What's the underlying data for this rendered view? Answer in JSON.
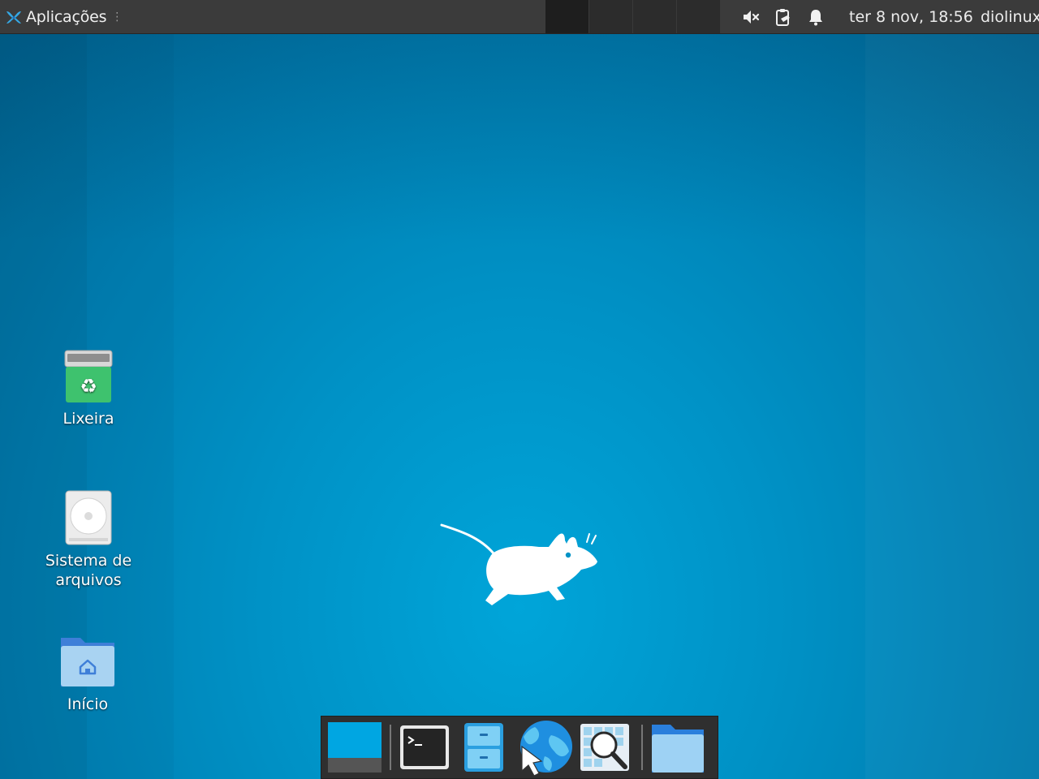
{
  "top_panel": {
    "apps_menu": {
      "label": "Aplicações",
      "icon": "xfce-logo-icon",
      "handle": "⋮"
    },
    "workspaces": [
      {
        "name": "workspace-1",
        "active": true
      },
      {
        "name": "workspace-2",
        "active": false
      },
      {
        "name": "workspace-3",
        "active": false
      },
      {
        "name": "workspace-4",
        "active": false
      }
    ],
    "tray": [
      {
        "icon": "volume-muted-icon"
      },
      {
        "icon": "clipboard-icon"
      },
      {
        "icon": "notification-bell-icon"
      }
    ],
    "clock": "ter  8 nov, 18:56",
    "user": "diolinux"
  },
  "desktop": {
    "icons": [
      {
        "label": "Lixeira",
        "icon": "trash-icon"
      },
      {
        "label": "Sistema de arquivos",
        "icon": "drive-icon"
      },
      {
        "label": "Início",
        "icon": "home-folder-icon"
      }
    ],
    "wallpaper_mascot": "xfce-mouse-icon"
  },
  "dock": {
    "items": [
      {
        "name": "show-desktop",
        "icon": "show-desktop-icon"
      },
      {
        "name": "terminal",
        "icon": "terminal-icon"
      },
      {
        "name": "file-manager",
        "icon": "file-cabinet-icon"
      },
      {
        "name": "web-browser",
        "icon": "web-browser-icon"
      },
      {
        "name": "app-finder",
        "icon": "app-finder-icon"
      },
      {
        "name": "home-folder",
        "icon": "folder-icon"
      }
    ]
  },
  "colors": {
    "panel": "#3b3b3b",
    "wallpaper": "#0092c6",
    "trash_green": "#3ec26e",
    "folder_blue": "#4a8de0"
  }
}
